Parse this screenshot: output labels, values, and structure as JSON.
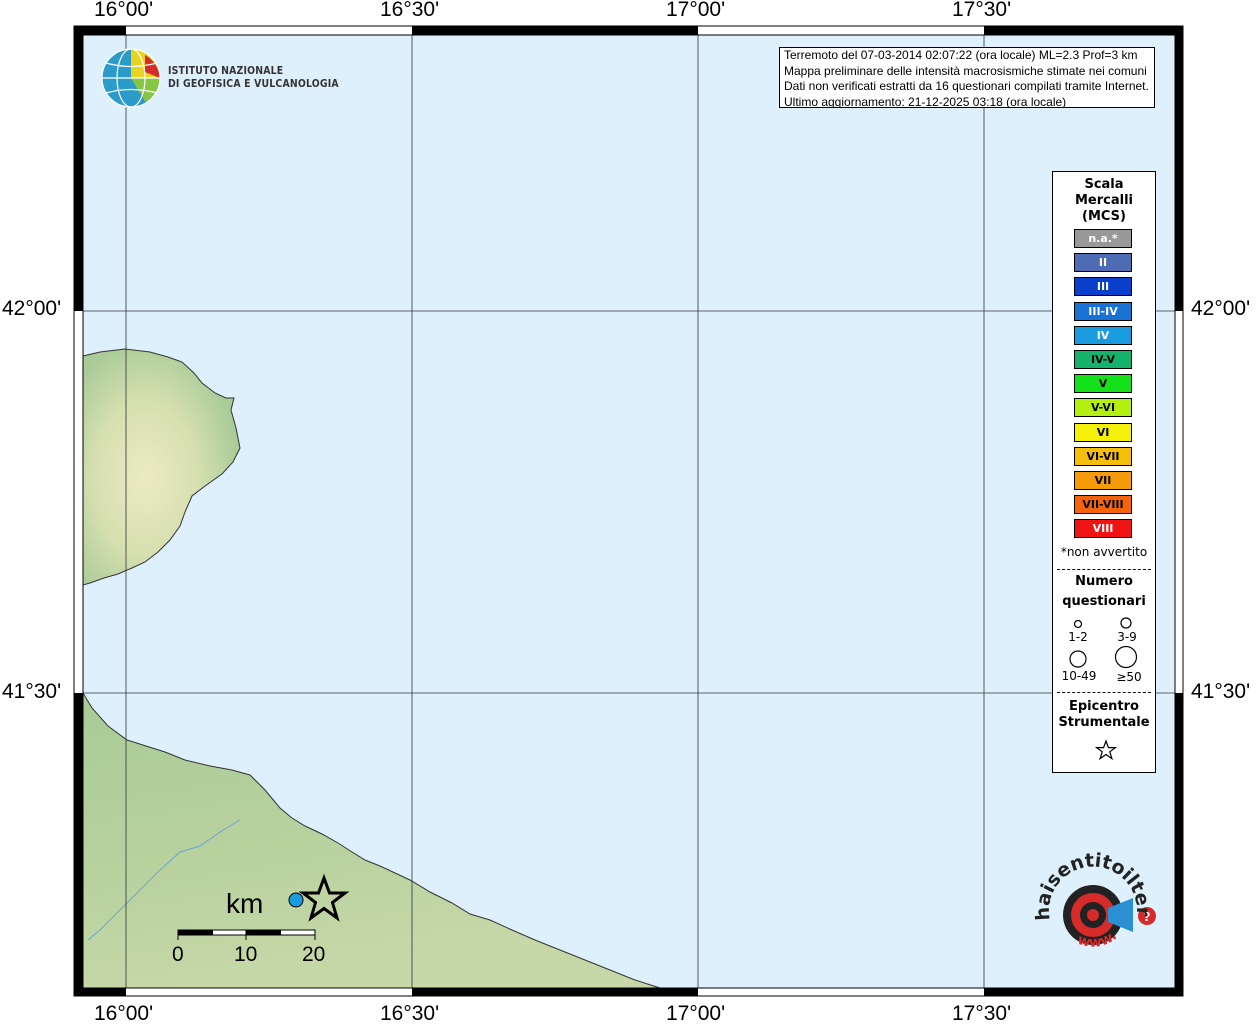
{
  "map": {
    "lon_labels_top": [
      "16°00'",
      "16°30'",
      "17°00'",
      "17°30'"
    ],
    "lon_labels_bottom": [
      "16°00'",
      "16°30'",
      "17°00'",
      "17°30'"
    ],
    "lat_labels_left": [
      "42°00'",
      "41°30'"
    ],
    "lat_labels_right": [
      "42°00'",
      "41°30'"
    ],
    "colors": {
      "sea": "#dff0fd",
      "land": "#9fc591",
      "land_light": "#e3e3b5"
    }
  },
  "logo": {
    "line1": "ISTITUTO NAZIONALE",
    "line2": "DI GEOFISICA E VULCANOLOGIA"
  },
  "info": {
    "line1": "Terremoto del 07-03-2014 02:07:22 (ora locale) ML=2.3 Prof=3 km",
    "line2": "Mappa preliminare delle intensità macrosismiche stimate nei comuni",
    "line3": "Dati non verificati estratti da 16 questionari compilati tramite Internet.",
    "line4": "Ultimo aggiornamento: 21-12-2025 03:18 (ora locale)"
  },
  "legend": {
    "title_line1": "Scala",
    "title_line2": "Mercalli",
    "title_line3": "(MCS)",
    "scale": [
      {
        "label": "n.a.*",
        "color": "#999999",
        "text_color": "#ffffff"
      },
      {
        "label": "II",
        "color": "#4e6cb4",
        "text_color": "#ffffff"
      },
      {
        "label": "III",
        "color": "#0a3fcb",
        "text_color": "#ffffff"
      },
      {
        "label": "III-IV",
        "color": "#1a71d6",
        "text_color": "#ffffff"
      },
      {
        "label": "IV",
        "color": "#1a9bdf",
        "text_color": "#ffffff"
      },
      {
        "label": "IV-V",
        "color": "#14b26a",
        "text_color": "#000000"
      },
      {
        "label": "V",
        "color": "#14e11a",
        "text_color": "#000000"
      },
      {
        "label": "V-VI",
        "color": "#b4f00f",
        "text_color": "#000000"
      },
      {
        "label": "VI",
        "color": "#f5f00a",
        "text_color": "#000000"
      },
      {
        "label": "VI-VII",
        "color": "#f5be0a",
        "text_color": "#000000"
      },
      {
        "label": "VII",
        "color": "#f59b0a",
        "text_color": "#000000"
      },
      {
        "label": "VII-VIII",
        "color": "#f5640a",
        "text_color": "#000000"
      },
      {
        "label": "VIII",
        "color": "#f01414",
        "text_color": "#ffffff"
      }
    ],
    "not_felt_note": "*non avvertito",
    "questionnaires_title_line1": "Numero",
    "questionnaires_title_line2": "questionari",
    "sizes": [
      "1-2",
      "3-9",
      "10-49",
      "≥50"
    ],
    "epicenter_title_line1": "Epicentro",
    "epicenter_title_line2": "Strumentale"
  },
  "scalebar": {
    "unit": "km",
    "labels": [
      "0",
      "10",
      "20"
    ]
  },
  "observations": [
    {
      "intensity": "IV",
      "color": "#1a9bdf",
      "lon": 16.29,
      "lat": 41.07
    }
  ],
  "epicenter": {
    "lon": 16.33,
    "lat": 41.07
  },
  "watermark": {
    "text": "haisentitoilterremoto.it",
    "url_text": "www."
  }
}
